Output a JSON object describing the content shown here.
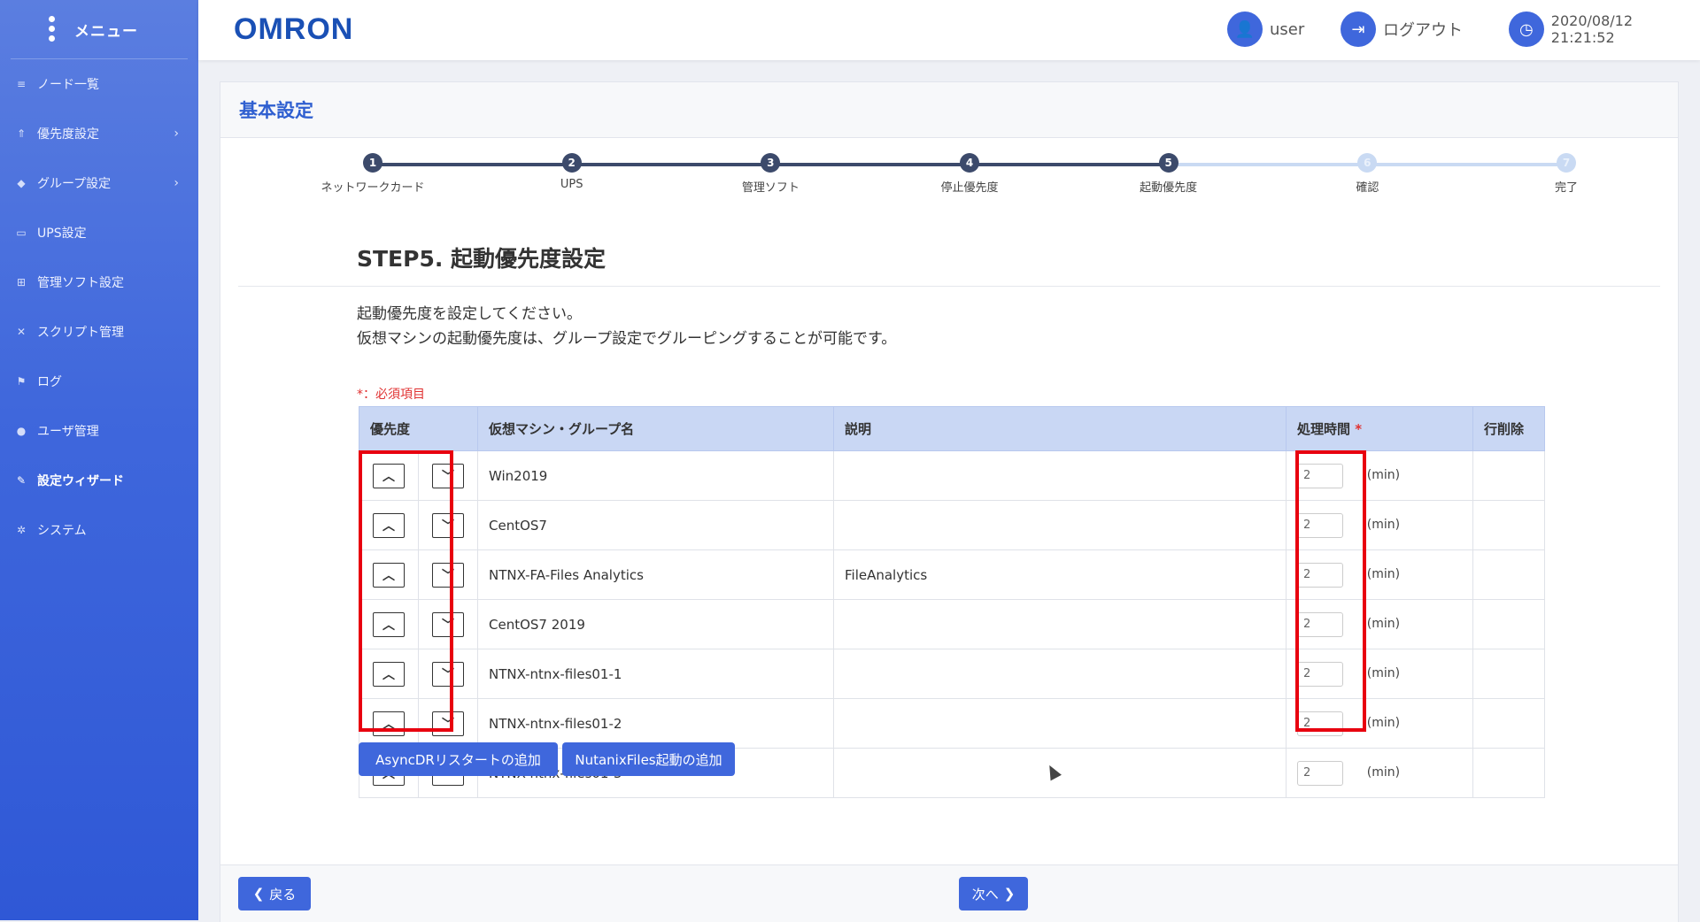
{
  "sidebar": {
    "title": "メニュー",
    "items": [
      {
        "label": "ノード一覧",
        "icon": "list-icon",
        "glyph": "≡",
        "chevron": false,
        "active": false
      },
      {
        "label": "優先度設定",
        "icon": "priority-icon",
        "glyph": "⇑",
        "chevron": true,
        "active": false
      },
      {
        "label": "グループ設定",
        "icon": "layers-icon",
        "glyph": "◆",
        "chevron": true,
        "active": false
      },
      {
        "label": "UPS設定",
        "icon": "battery-icon",
        "glyph": "▭",
        "chevron": false,
        "active": false
      },
      {
        "label": "管理ソフト設定",
        "icon": "sitemap-icon",
        "glyph": "⊞",
        "chevron": false,
        "active": false
      },
      {
        "label": "スクリプト管理",
        "icon": "code-icon",
        "glyph": "✕",
        "chevron": false,
        "active": false
      },
      {
        "label": "ログ",
        "icon": "flag-icon",
        "glyph": "⚑",
        "chevron": false,
        "active": false
      },
      {
        "label": "ユーザ管理",
        "icon": "user-icon",
        "glyph": "●",
        "chevron": false,
        "active": false
      },
      {
        "label": "設定ウィザード",
        "icon": "edit-icon",
        "glyph": "✎",
        "chevron": false,
        "active": true
      },
      {
        "label": "システム",
        "icon": "gear-icon",
        "glyph": "✲",
        "chevron": false,
        "active": false
      }
    ]
  },
  "header": {
    "logo": "OMRON",
    "user_label": "user",
    "logout_label": "ログアウト",
    "datetime": "2020/08/12 21:21:52"
  },
  "page": {
    "title": "基本設定",
    "step_title": "STEP5. 起動優先度設定",
    "desc_line1": "起動優先度を設定してください。",
    "desc_line2": "仮想マシンの起動優先度は、グループ設定でグルーピングすることが可能です。",
    "required_note": "*：必須項目"
  },
  "stepper": [
    {
      "num": "1",
      "label": "ネットワークカード",
      "state": "done"
    },
    {
      "num": "2",
      "label": "UPS",
      "state": "done"
    },
    {
      "num": "3",
      "label": "管理ソフト",
      "state": "done"
    },
    {
      "num": "4",
      "label": "停止優先度",
      "state": "done"
    },
    {
      "num": "5",
      "label": "起動優先度",
      "state": "done"
    },
    {
      "num": "6",
      "label": "確認",
      "state": "todo"
    },
    {
      "num": "7",
      "label": "完了",
      "state": "todo"
    }
  ],
  "table": {
    "headers": {
      "priority": "優先度",
      "name": "仮想マシン・グループ名",
      "description": "説明",
      "time": "処理時間",
      "time_required": "*",
      "delete": "行削除"
    },
    "rows": [
      {
        "name": "Win2019",
        "description": "",
        "time": "2",
        "unit": "(min)"
      },
      {
        "name": "CentOS7",
        "description": "",
        "time": "2",
        "unit": "(min)"
      },
      {
        "name": "NTNX-FA-Files Analytics",
        "description": "FileAnalytics",
        "time": "2",
        "unit": "(min)"
      },
      {
        "name": " CentOS7 2019",
        "description": "",
        "time": "2",
        "unit": "(min)"
      },
      {
        "name": "NTNX-ntnx-files01-1",
        "description": "",
        "time": "2",
        "unit": "(min)"
      },
      {
        "name": "NTNX-ntnx-files01-2",
        "description": "",
        "time": "2",
        "unit": "(min)"
      },
      {
        "name": "NTNX-ntnx-files01-3",
        "description": "",
        "time": "2",
        "unit": "(min)"
      }
    ]
  },
  "buttons": {
    "add_asyncdr": "AsyncDRリスタートの追加",
    "add_nutanix": "NutanixFiles起動の追加",
    "back": "戻る",
    "next": "次へ"
  },
  "colors": {
    "accent": "#3f67dc",
    "highlight": "#e8000f",
    "header_bg": "#c9d7f4"
  }
}
